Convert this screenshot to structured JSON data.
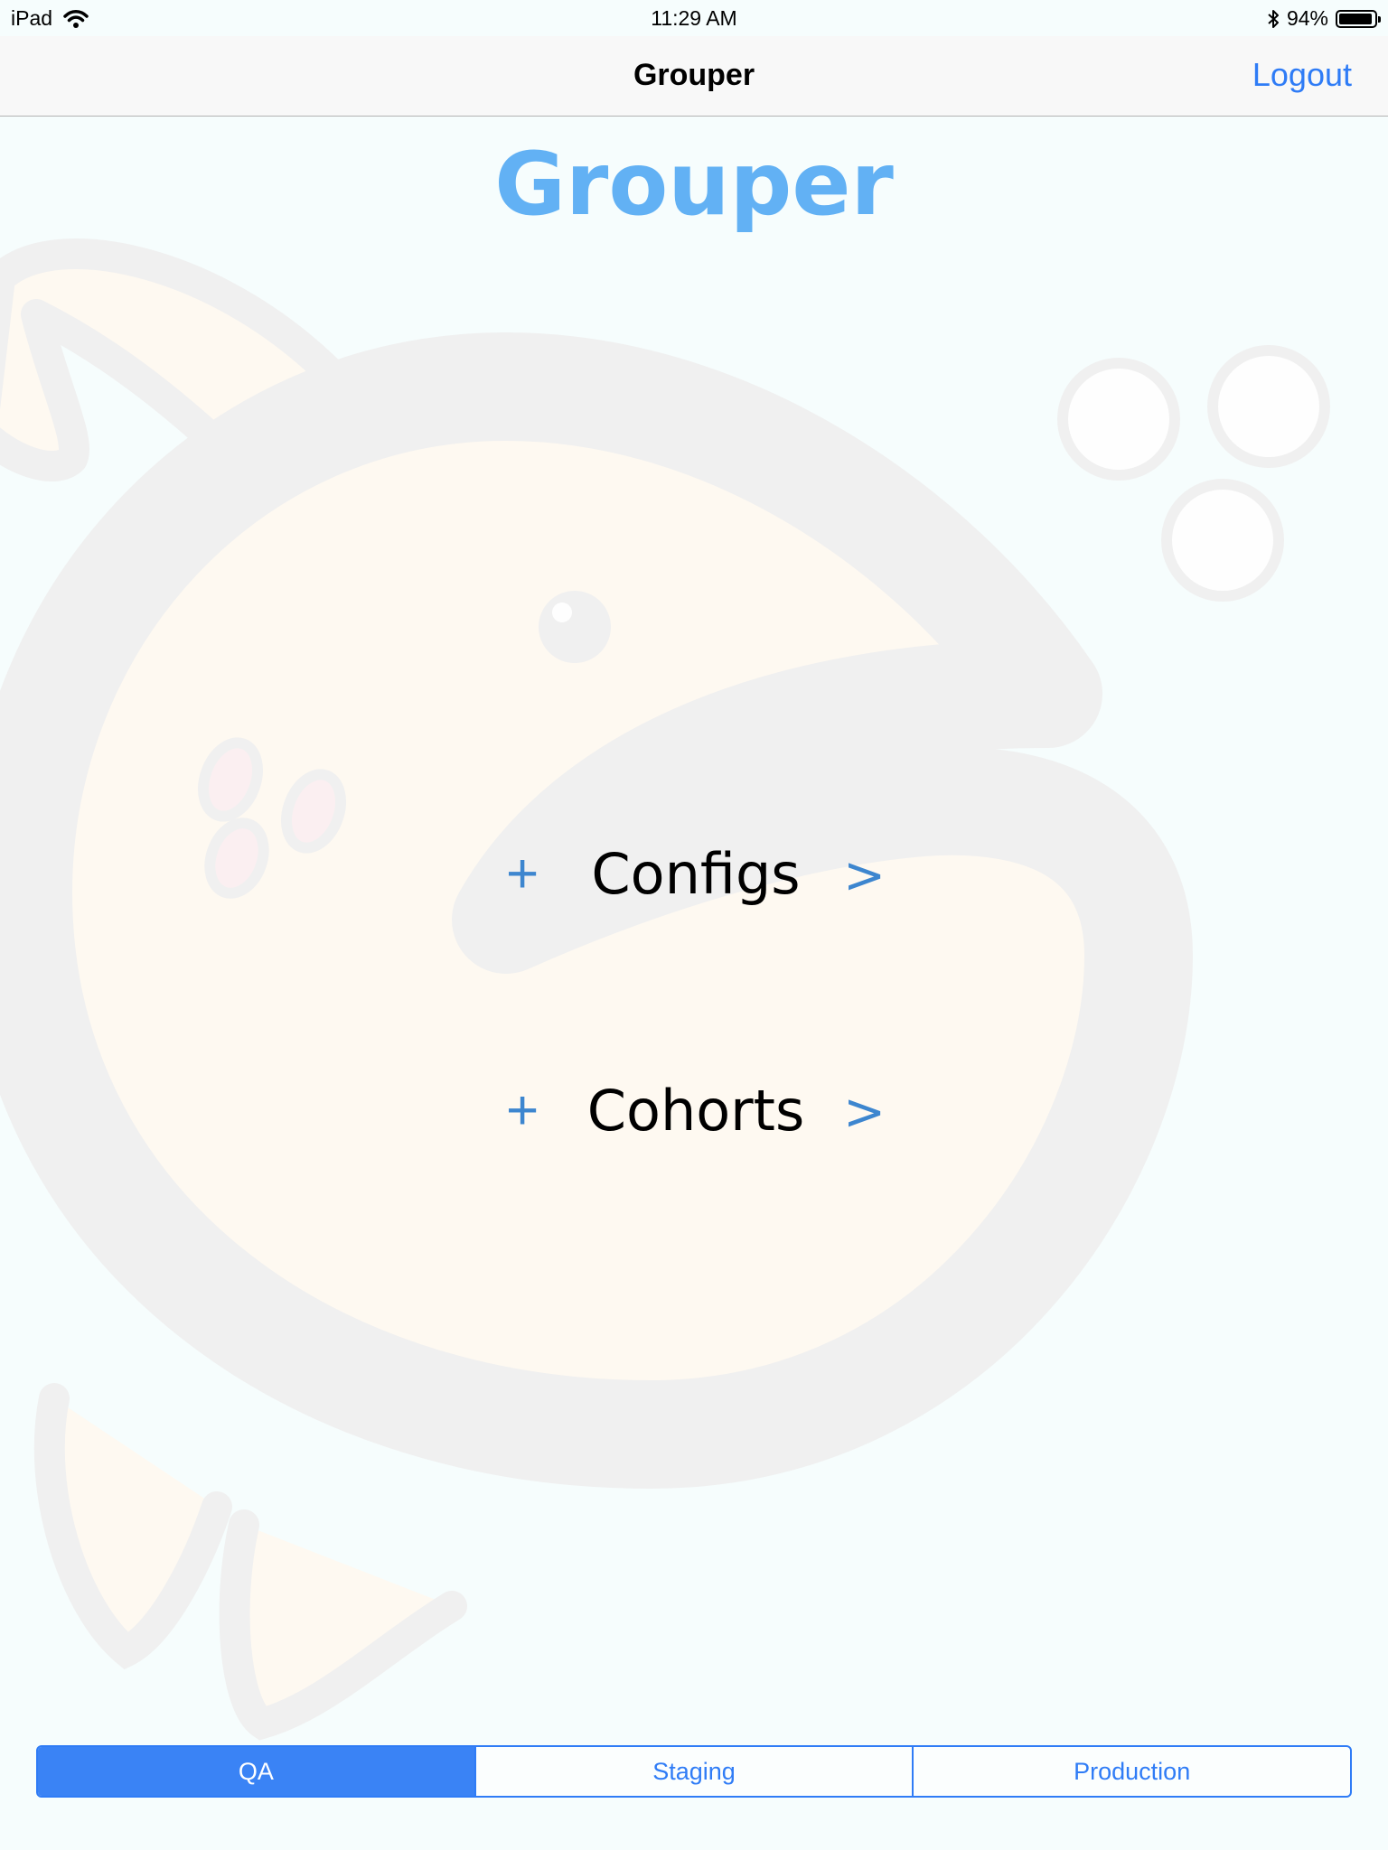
{
  "status_bar": {
    "device": "iPad",
    "time": "11:29 AM",
    "battery": "94%",
    "battery_level": 0.94
  },
  "nav": {
    "title": "Grouper",
    "logout_label": "Logout"
  },
  "main": {
    "heading": "Grouper",
    "items": [
      {
        "plus": "+",
        "label": "Configs",
        "arrow": ">"
      },
      {
        "plus": "+",
        "label": "Cohorts",
        "arrow": ">"
      }
    ]
  },
  "environment": {
    "segments": [
      "QA",
      "Staging",
      "Production"
    ],
    "selected": "QA"
  },
  "colors": {
    "accent": "#2f7cf6",
    "heading": "#62b1f4",
    "menu_icon": "#3d86cf"
  },
  "icons": {
    "wifi": "wifi-icon",
    "bluetooth": "bluetooth-icon",
    "battery": "battery-icon"
  }
}
